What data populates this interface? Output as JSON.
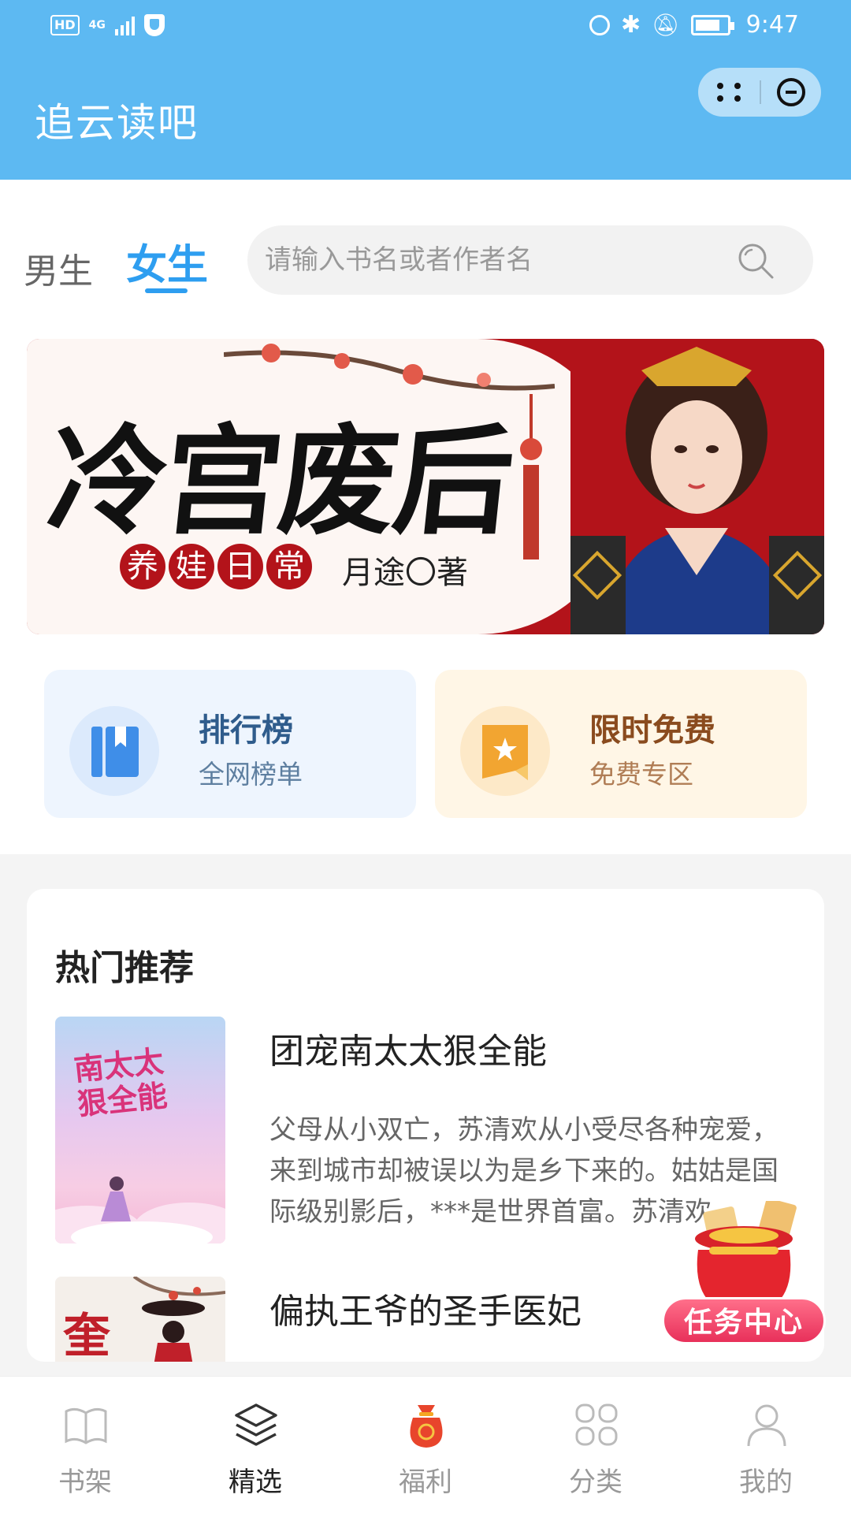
{
  "status_bar": {
    "hd_label": "HD",
    "network_label": "4G",
    "time": "9:47"
  },
  "header": {
    "app_title": "追云读吧",
    "bg_color": "#5db9f2"
  },
  "gender_tabs": [
    {
      "label": "男生",
      "active": false
    },
    {
      "label": "女生",
      "active": true
    }
  ],
  "search": {
    "placeholder": "请输入书名或者作者名"
  },
  "banner": {
    "title": "冷宫废后",
    "subtitle_chars": [
      "养",
      "娃",
      "日",
      "常"
    ],
    "author": "月途〇著"
  },
  "quick_entries": {
    "rank": {
      "title": "排行榜",
      "subtitle": "全网榜单"
    },
    "free": {
      "title": "限时免费",
      "subtitle": "免费专区"
    }
  },
  "recommend": {
    "title": "热门推荐",
    "books": [
      {
        "name": "团宠南太太狠全能",
        "cover_text": "南太太\n狠全能",
        "desc": "父母从小双亡，苏清欢从小受尽各种宠爱，来到城市却被误以为是乡下来的。姑姑是国际级别影后，***是世界首富。苏清欢..."
      },
      {
        "name": "偏执王爷的圣手医妃",
        "cover_text": "",
        "desc": ""
      }
    ]
  },
  "task_center": {
    "label": "任务中心"
  },
  "tabbar": [
    {
      "label": "书架",
      "icon": "book-icon",
      "active": false
    },
    {
      "label": "精选",
      "icon": "layers-icon",
      "active": true
    },
    {
      "label": "福利",
      "icon": "lucky-bag-icon",
      "active": false
    },
    {
      "label": "分类",
      "icon": "grid-icon",
      "active": false
    },
    {
      "label": "我的",
      "icon": "user-icon",
      "active": false
    }
  ],
  "colors": {
    "accent": "#2e9ef0",
    "fuli": "#e8452c"
  }
}
